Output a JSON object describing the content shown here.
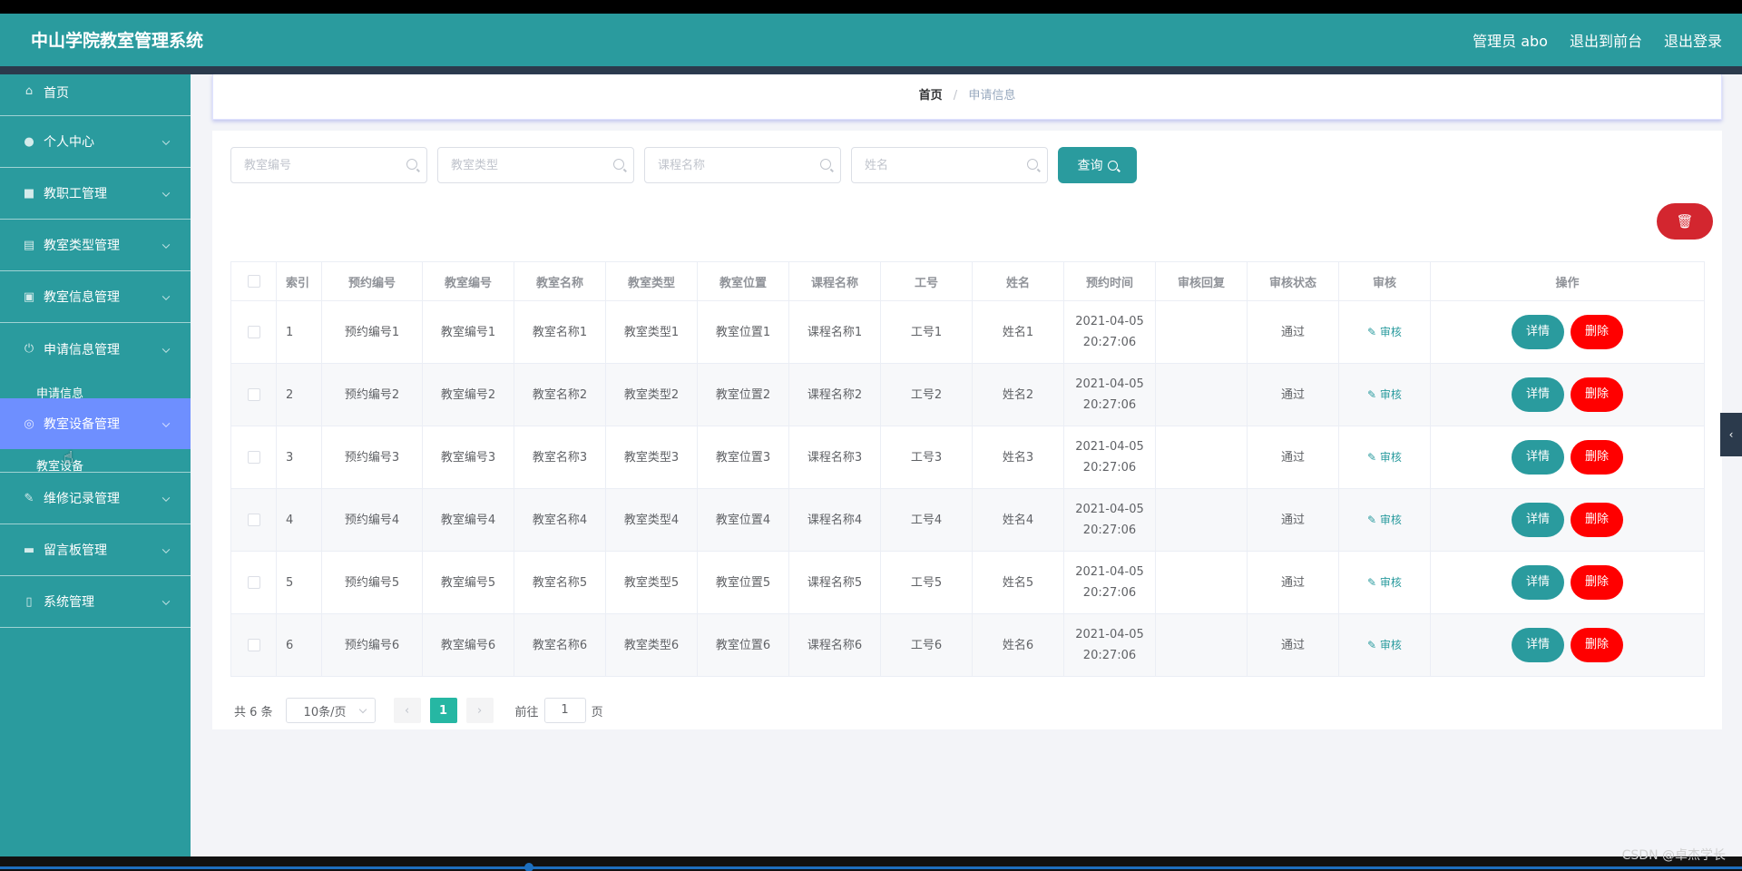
{
  "app": {
    "title": "中山学院教室管理系统"
  },
  "header": {
    "user": "管理员 abo",
    "to_front": "退出到前台",
    "logout": "退出登录"
  },
  "sidebar": {
    "items": [
      {
        "label": "首页",
        "icon": "home-icon"
      },
      {
        "label": "个人中心",
        "icon": "user-icon"
      },
      {
        "label": "教职工管理",
        "icon": "briefcase-icon"
      },
      {
        "label": "教室类型管理",
        "icon": "clipboard-icon"
      },
      {
        "label": "教室信息管理",
        "icon": "clipboard-check-icon"
      },
      {
        "label": "申请信息管理",
        "icon": "power-icon"
      },
      {
        "label": "教室设备管理",
        "icon": "globe-icon"
      },
      {
        "label": "维修记录管理",
        "icon": "edit-icon"
      },
      {
        "label": "留言板管理",
        "icon": "message-icon"
      },
      {
        "label": "系统管理",
        "icon": "phone-icon"
      }
    ],
    "sub_apply": "申请信息",
    "sub_equipment": "教室设备"
  },
  "breadcrumb": {
    "home": "首页",
    "current": "申请信息"
  },
  "search": {
    "room_no_placeholder": "教室编号",
    "room_type_placeholder": "教室类型",
    "course_placeholder": "课程名称",
    "name_placeholder": "姓名",
    "query_label": "查询"
  },
  "table": {
    "headers": [
      "索引",
      "预约编号",
      "教室编号",
      "教室名称",
      "教室类型",
      "教室位置",
      "课程名称",
      "工号",
      "姓名",
      "预约时间",
      "审核回复",
      "审核状态",
      "审核",
      "操作"
    ],
    "audit_label": "审核",
    "detail_label": "详情",
    "delete_label": "删除",
    "rows": [
      {
        "idx": "1",
        "booking": "预约编号1",
        "room_no": "教室编号1",
        "room_name": "教室名称1",
        "room_type": "教室类型1",
        "location": "教室位置1",
        "course": "课程名称1",
        "staff_no": "工号1",
        "name": "姓名1",
        "date": "2021-04-05",
        "time": "20:27:06",
        "reply": "",
        "status": "通过"
      },
      {
        "idx": "2",
        "booking": "预约编号2",
        "room_no": "教室编号2",
        "room_name": "教室名称2",
        "room_type": "教室类型2",
        "location": "教室位置2",
        "course": "课程名称2",
        "staff_no": "工号2",
        "name": "姓名2",
        "date": "2021-04-05",
        "time": "20:27:06",
        "reply": "",
        "status": "通过"
      },
      {
        "idx": "3",
        "booking": "预约编号3",
        "room_no": "教室编号3",
        "room_name": "教室名称3",
        "room_type": "教室类型3",
        "location": "教室位置3",
        "course": "课程名称3",
        "staff_no": "工号3",
        "name": "姓名3",
        "date": "2021-04-05",
        "time": "20:27:06",
        "reply": "",
        "status": "通过"
      },
      {
        "idx": "4",
        "booking": "预约编号4",
        "room_no": "教室编号4",
        "room_name": "教室名称4",
        "room_type": "教室类型4",
        "location": "教室位置4",
        "course": "课程名称4",
        "staff_no": "工号4",
        "name": "姓名4",
        "date": "2021-04-05",
        "time": "20:27:06",
        "reply": "",
        "status": "通过"
      },
      {
        "idx": "5",
        "booking": "预约编号5",
        "room_no": "教室编号5",
        "room_name": "教室名称5",
        "room_type": "教室类型5",
        "location": "教室位置5",
        "course": "课程名称5",
        "staff_no": "工号5",
        "name": "姓名5",
        "date": "2021-04-05",
        "time": "20:27:06",
        "reply": "",
        "status": "通过"
      },
      {
        "idx": "6",
        "booking": "预约编号6",
        "room_no": "教室编号6",
        "room_name": "教室名称6",
        "room_type": "教室类型6",
        "location": "教室位置6",
        "course": "课程名称6",
        "staff_no": "工号6",
        "name": "姓名6",
        "date": "2021-04-05",
        "time": "20:27:06",
        "reply": "",
        "status": "通过"
      }
    ]
  },
  "pagination": {
    "total": "共 6 条",
    "page_size": "10条/页",
    "current_page": "1",
    "goto_prefix": "前往",
    "goto_value": "1",
    "goto_suffix": "页"
  },
  "watermark": "CSDN @卓杰学长",
  "colors": {
    "primary": "#2a9b9e",
    "active_menu": "#6e8fff",
    "danger": "#ff0000",
    "pager_active": "#26b7a3"
  }
}
